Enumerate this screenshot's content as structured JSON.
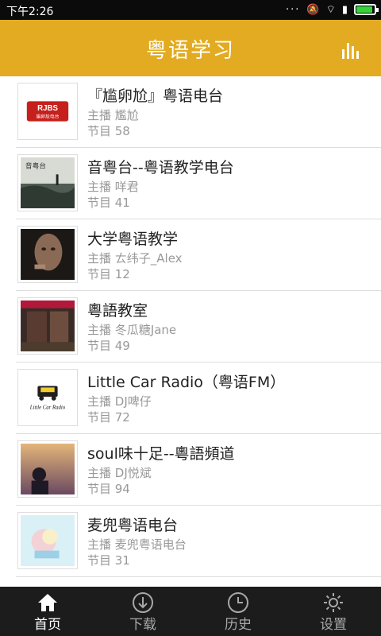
{
  "status_bar": {
    "time": "下午2:26",
    "battery_level": 0.9
  },
  "app_bar": {
    "title": "粤语学习",
    "icon": "bar-chart-icon"
  },
  "stations": [
    {
      "title": "『尴卵尬』粤语电台",
      "host": "主播 尷尬",
      "episodes": "节目 58",
      "thumb": "rjbs-logo"
    },
    {
      "title": "音粤台--粤语教学电台",
      "host": "主播 咩君",
      "episodes": "节目 41",
      "thumb": "sea-photo"
    },
    {
      "title": "大学粤语教学",
      "host": "主播 ㄊ纬子_Alex",
      "episodes": "节目 12",
      "thumb": "portrait-photo"
    },
    {
      "title": "粵語教室",
      "host": "主播 冬瓜糖Jane",
      "episodes": "节目 49",
      "thumb": "shop-photo"
    },
    {
      "title": "Little Car Radio（粤语FM）",
      "host": "主播 DJ啤仔",
      "episodes": "节目 72",
      "thumb": "car-logo"
    },
    {
      "title": "soul味十足--粵語頻道",
      "host": "主播 DJ悦斌",
      "episodes": "节目 94",
      "thumb": "sunset-photo"
    },
    {
      "title": "麦兜粤语电台",
      "host": "主播 麦兜粤语电台",
      "episodes": "节目 31",
      "thumb": "cartoon-image"
    }
  ],
  "thumb_text": {
    "rjbs_logo_text": "RJBS",
    "rjbs_logo_subtext": "尴卵尬电台",
    "sea_photo_text": "音粤台",
    "car_logo_text": "Little Car Radio"
  },
  "tabs": [
    {
      "label": "首页",
      "icon": "home-icon",
      "active": true
    },
    {
      "label": "下载",
      "icon": "download-icon",
      "active": false
    },
    {
      "label": "历史",
      "icon": "clock-icon",
      "active": false
    },
    {
      "label": "设置",
      "icon": "gear-icon",
      "active": false
    }
  ],
  "colors": {
    "app_bar": "#e2ab21",
    "tab_bar": "#1c1c1c",
    "status_bar": "#0b0b0b"
  }
}
